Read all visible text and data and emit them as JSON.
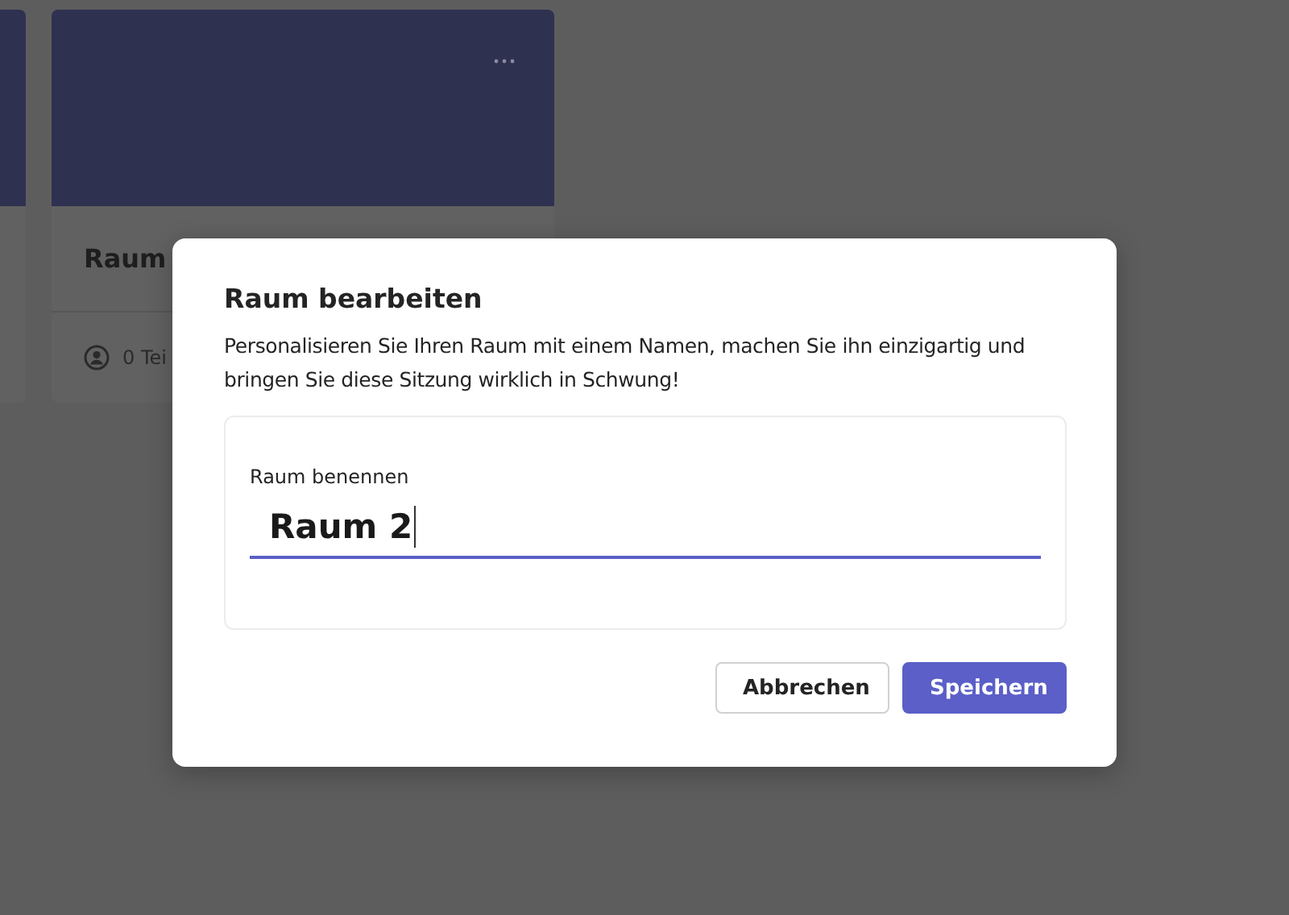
{
  "background_cards": [
    {
      "kind": "blank"
    },
    {
      "kind": "room",
      "title": "Raum",
      "meta": "0 Tei"
    }
  ],
  "dialog": {
    "title": "Raum bearbeiten",
    "description": "Personalisieren Sie Ihren Raum mit einem Namen, machen Sie ihn einzigartig und bringen Sie diese Sitzung wirklich in Schwung!",
    "field": {
      "label": "Raum benennen",
      "value": "Raum 2",
      "focused": true
    },
    "buttons": [
      {
        "label": "Abbrechen",
        "kind": "secondary"
      },
      {
        "label": "Speichern",
        "kind": "primary"
      }
    ]
  }
}
